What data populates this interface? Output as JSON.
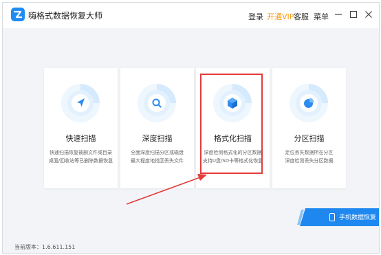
{
  "app": {
    "title": "嗨格式数据恢复大师",
    "version_label": "当前版本：1.6.611.151"
  },
  "header": {
    "login": "登录",
    "vip": "开通VIP",
    "service": "客服",
    "menu": "菜单",
    "vip_color": "#f29b0f"
  },
  "cards": [
    {
      "title": "快速扫描",
      "icon": "navigation-arrow-icon",
      "desc": [
        "快速扫描恢复被删文件或目录",
        "桌面/回收站等已删除数据恢复"
      ]
    },
    {
      "title": "深度扫描",
      "icon": "magnifier-icon",
      "desc": [
        "全面深度扫描分区或磁盘",
        "最大程度地找回丢失文件"
      ]
    },
    {
      "title": "格式化扫描",
      "icon": "cube-icon",
      "desc": [
        "深度检测格式化的分区数据",
        "支持U盘/SD卡等格式化恢复"
      ]
    },
    {
      "title": "分区扫描",
      "icon": "pie-chart-icon",
      "desc": [
        "定位丢失数据所在分区",
        "深度检测丢失分区数据"
      ]
    }
  ],
  "mobile_button": {
    "label": "手机数据恢复"
  },
  "colors": {
    "accent": "#1e88f0",
    "highlight": "#e23b3b",
    "background": "#f3f4f7"
  }
}
